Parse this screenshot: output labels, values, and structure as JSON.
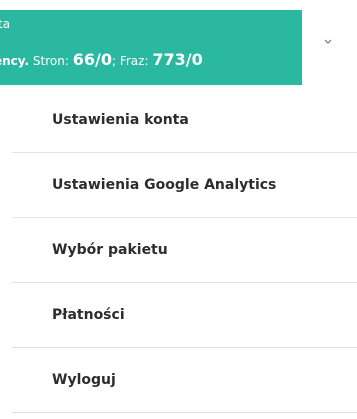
{
  "account": {
    "name_fragment": "ta",
    "label_fragment": "ency.",
    "pages_label": "Stron:",
    "pages_value": "66/0",
    "separator": ";",
    "phrases_label": "Fraz:",
    "phrases_value": "773/0",
    "bg_color": "#2bb8a0"
  },
  "chevron_icon": "chevron-down-icon",
  "menu": {
    "items": [
      {
        "label": "Ustawienia konta"
      },
      {
        "label": "Ustawienia Google Analytics"
      },
      {
        "label": "Wybór pakietu"
      },
      {
        "label": "Płatności"
      },
      {
        "label": "Wyloguj"
      }
    ]
  }
}
